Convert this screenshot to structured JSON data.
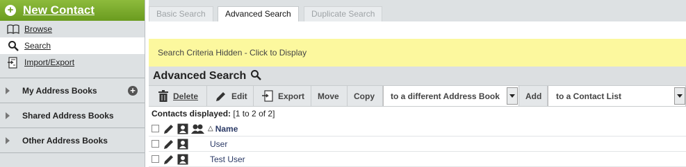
{
  "sidebar": {
    "new_contact_label": "New Contact",
    "nav": [
      {
        "label": "Browse",
        "icon": "book-icon"
      },
      {
        "label": "Search",
        "icon": "search-icon"
      },
      {
        "label": "Import/Export",
        "icon": "import-export-icon"
      }
    ],
    "sections": [
      {
        "label": "My Address Books"
      },
      {
        "label": "Shared Address Books"
      },
      {
        "label": "Other Address Books"
      }
    ]
  },
  "tabs": [
    {
      "label": "Basic Search",
      "active": false
    },
    {
      "label": "Advanced Search",
      "active": true
    },
    {
      "label": "Duplicate Search",
      "active": false
    }
  ],
  "criteria_text": "Search Criteria Hidden - Click to Display",
  "header_title": "Advanced Search",
  "toolbar": {
    "delete": "Delete",
    "edit": "Edit",
    "export": "Export",
    "move": "Move",
    "copy": "Copy",
    "address_book_select": "to a different Address Book",
    "add": "Add",
    "contact_list_select": "to a Contact List"
  },
  "contacts_displayed": {
    "label": "Contacts displayed:",
    "value": "[1 to 2 of 2]"
  },
  "table": {
    "column_name": "Name",
    "sort_indicator": "△",
    "rows": [
      {
        "name": "User"
      },
      {
        "name": "Test User"
      }
    ]
  },
  "colors": {
    "accent_green": "#7aab2c",
    "criteria_yellow": "#fcf89e",
    "link_blue": "#2b3a66"
  }
}
